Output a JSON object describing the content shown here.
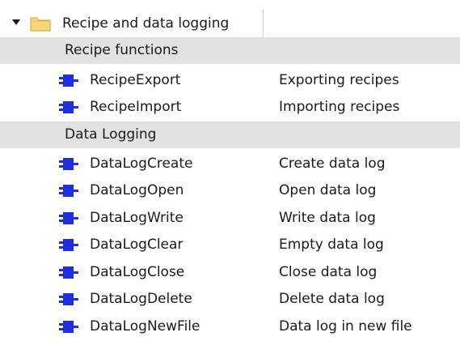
{
  "tree": {
    "root": {
      "label": "Recipe and data logging",
      "icon": "folder-icon",
      "expander_icon": "triangle-down-icon"
    },
    "groups": [
      {
        "label": "Recipe functions",
        "items": [
          {
            "name": "RecipeExport",
            "description": "Exporting recipes",
            "icon": "function-block-icon"
          },
          {
            "name": "RecipeImport",
            "description": "Importing recipes",
            "icon": "function-block-icon"
          }
        ]
      },
      {
        "label": "Data Logging",
        "items": [
          {
            "name": "DataLogCreate",
            "description": "Create data log",
            "icon": "function-block-icon"
          },
          {
            "name": "DataLogOpen",
            "description": "Open data log",
            "icon": "function-block-icon"
          },
          {
            "name": "DataLogWrite",
            "description": "Write data log",
            "icon": "function-block-icon"
          },
          {
            "name": "DataLogClear",
            "description": "Empty data log",
            "icon": "function-block-icon"
          },
          {
            "name": "DataLogClose",
            "description": "Close data log",
            "icon": "function-block-icon"
          },
          {
            "name": "DataLogDelete",
            "description": "Delete data log",
            "icon": "function-block-icon"
          },
          {
            "name": "DataLogNewFile",
            "description": "Data log in new file",
            "icon": "function-block-icon"
          }
        ]
      }
    ]
  },
  "colors": {
    "group_background": "#e2e2e2",
    "icon_blue": "#1e2fe0",
    "folder_yellow": "#f7d77a"
  }
}
